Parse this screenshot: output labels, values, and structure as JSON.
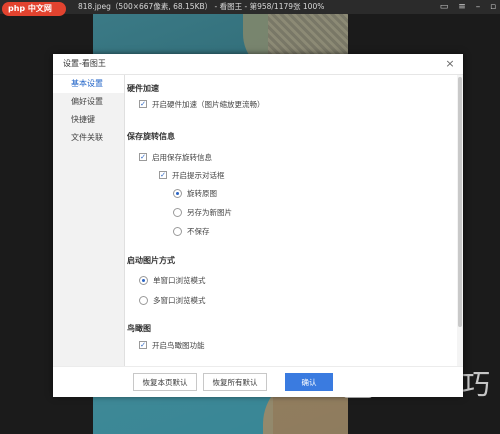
{
  "viewer": {
    "title": "818.jpeg（500×667像素, 68.15KB） - 看图王 - 第958/1179张 100%",
    "logo_text": "php 中文网",
    "watermark_text": "软件技巧"
  },
  "dialog": {
    "title": "设置-看图王",
    "close": "×",
    "nav": [
      "基本设置",
      "偏好设置",
      "快捷键",
      "文件关联"
    ],
    "sections": {
      "hw_title": "硬件加速",
      "hw_option": "开启硬件加速（图片缩放更流畅）",
      "rotate_title": "保存旋转信息",
      "rotate_enable": "启用保存旋转信息",
      "rotate_prompt": "开启提示对话框",
      "rotate_radios": [
        "旋转原图",
        "另存为新图片",
        "不保存"
      ],
      "open_title": "启动图片方式",
      "open_radios": [
        "单窗口浏览模式",
        "多窗口浏览模式"
      ],
      "bird_title": "鸟瞰图",
      "bird_option": "开启鸟瞰图功能"
    },
    "buttons": {
      "restore_page": "恢复本页默认",
      "restore_all": "恢复所有默认",
      "confirm": "确认"
    }
  }
}
